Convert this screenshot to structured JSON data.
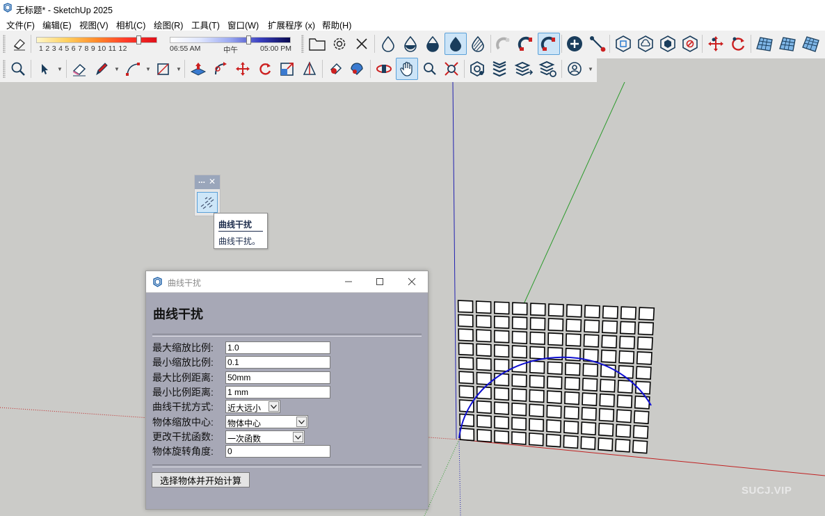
{
  "window": {
    "title": "无标题* - SketchUp 2025"
  },
  "menu": [
    "文件(F)",
    "编辑(E)",
    "视图(V)",
    "相机(C)",
    "绘图(R)",
    "工具(T)",
    "窗口(W)",
    "扩展程序 (x)",
    "帮助(H)"
  ],
  "shadow_slider": {
    "month_labels": "1 2 3 4 5 6 7 8 9 10 11 12",
    "month_value": 0.85
  },
  "time_slider": {
    "start": "06:55 AM",
    "mid": "中午",
    "end": "05:00 PM",
    "value": 0.66
  },
  "toolbar": {
    "row1_icons": [
      "eraser-icon",
      "folder-icon",
      "gear-icon",
      "x-icon",
      "drop-outline-icon",
      "drop-half-icon",
      "drop-full-icon",
      "drop-active-icon",
      "drop-hatched-icon",
      "magnet-broken-icon",
      "magnet-icon",
      "magnet-active-icon",
      "plus-circle-icon",
      "line-connect-icon",
      "hex-cube-icon",
      "hex-cloud-icon",
      "hex-solid-icon",
      "hex-forbidden-icon",
      "move-red-icon",
      "rotate-red-icon",
      "grid-surface-icon",
      "grid-surface-2-icon",
      "grid-surface-3-icon"
    ],
    "row2_icons": [
      "zoom-icon",
      "select-icon",
      "eraser-icon",
      "pencil-icon",
      "curve-icon",
      "rectangle-icon",
      "pushpull-icon",
      "followme-icon",
      "move-icon",
      "rotate-icon",
      "scale-icon",
      "tape-icon",
      "paint-icon",
      "section-icon",
      "orbit-icon",
      "pan-icon",
      "zoom2-icon",
      "zoom-extents-icon",
      "layers-gear-icon",
      "layers-icon",
      "layers-arrow-icon",
      "layers-settings-icon",
      "user-icon"
    ]
  },
  "floating_panel": {
    "icon": "curve-interference-icon",
    "close": "✕",
    "menu": "..."
  },
  "tooltip": {
    "title": "曲线干扰",
    "body": "曲线干扰。"
  },
  "dialog": {
    "title": "曲线干扰",
    "heading": "曲线干扰",
    "fields": [
      {
        "label": "最大缩放比例:",
        "value": "1.0",
        "kind": "text"
      },
      {
        "label": "最小缩放比例:",
        "value": "0.1",
        "kind": "text"
      },
      {
        "label": "最大比例距离:",
        "value": "50mm",
        "kind": "text"
      },
      {
        "label": "最小比例距离:",
        "value": "1 mm",
        "kind": "text"
      },
      {
        "label": "曲线干扰方式:",
        "value": "近大远小",
        "kind": "select"
      },
      {
        "label": "物体缩放中心:",
        "value": "物体中心",
        "kind": "select"
      },
      {
        "label": "更改干扰函数:",
        "value": "一次函数",
        "kind": "select"
      },
      {
        "label": "物体旋转角度:",
        "value": "0",
        "kind": "text"
      }
    ],
    "button": "选择物体并开始计算"
  },
  "watermark": "SUCJ.VIP",
  "colors": {
    "accent": "#cce4f7",
    "dialog_bg": "#a7a8b6",
    "viewport_bg": "#cbcbc8",
    "axis_red": "#c02020",
    "axis_green": "#2a9a2a",
    "axis_blue": "#2020b0"
  }
}
